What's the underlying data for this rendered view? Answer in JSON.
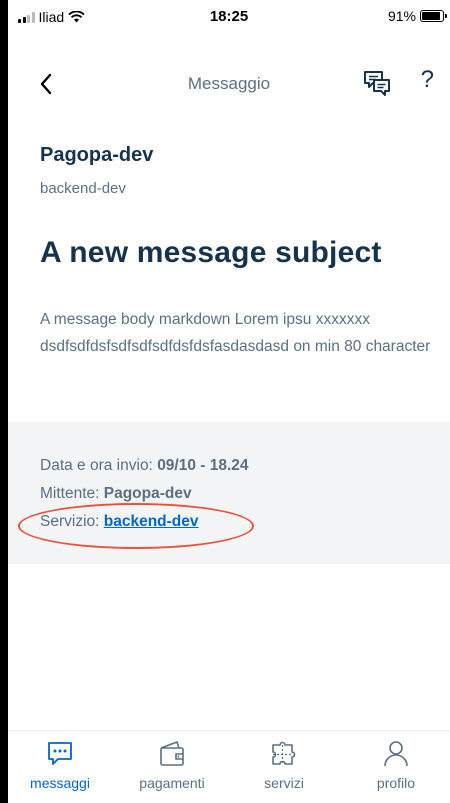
{
  "status_bar": {
    "carrier": "Iliad",
    "time": "18:25",
    "battery": "91%",
    "battery_level": 0.91
  },
  "nav": {
    "title": "Messaggio",
    "back_icon": "chevron-left-icon",
    "chat_icon": "chat-icon",
    "help_label": "?"
  },
  "message": {
    "organization": "Pagopa-dev",
    "service": "backend-dev",
    "subject": "A new message subject",
    "body": "A message body markdown Lorem ipsu xxxxxxx dsdfsdfdsfsdfsdfsdfdsfdsfasdasdasd on min 80 character"
  },
  "details": {
    "date_label": "Data e ora invio: ",
    "date_value": "09/10 - 18.24",
    "sender_label": "Mittente: ",
    "sender_value": "Pagopa-dev",
    "service_label": "Servizio: ",
    "service_value": "backend-dev"
  },
  "tabs": [
    {
      "label": "messaggi",
      "icon": "message-icon",
      "active": true
    },
    {
      "label": "pagamenti",
      "icon": "wallet-icon",
      "active": false
    },
    {
      "label": "servizi",
      "icon": "puzzle-icon",
      "active": false
    },
    {
      "label": "profilo",
      "icon": "user-icon",
      "active": false
    }
  ],
  "colors": {
    "primary_text": "#17324d",
    "secondary_text": "#5c6f82",
    "link": "#0066cc",
    "highlight_annotation": "#e8543a"
  }
}
